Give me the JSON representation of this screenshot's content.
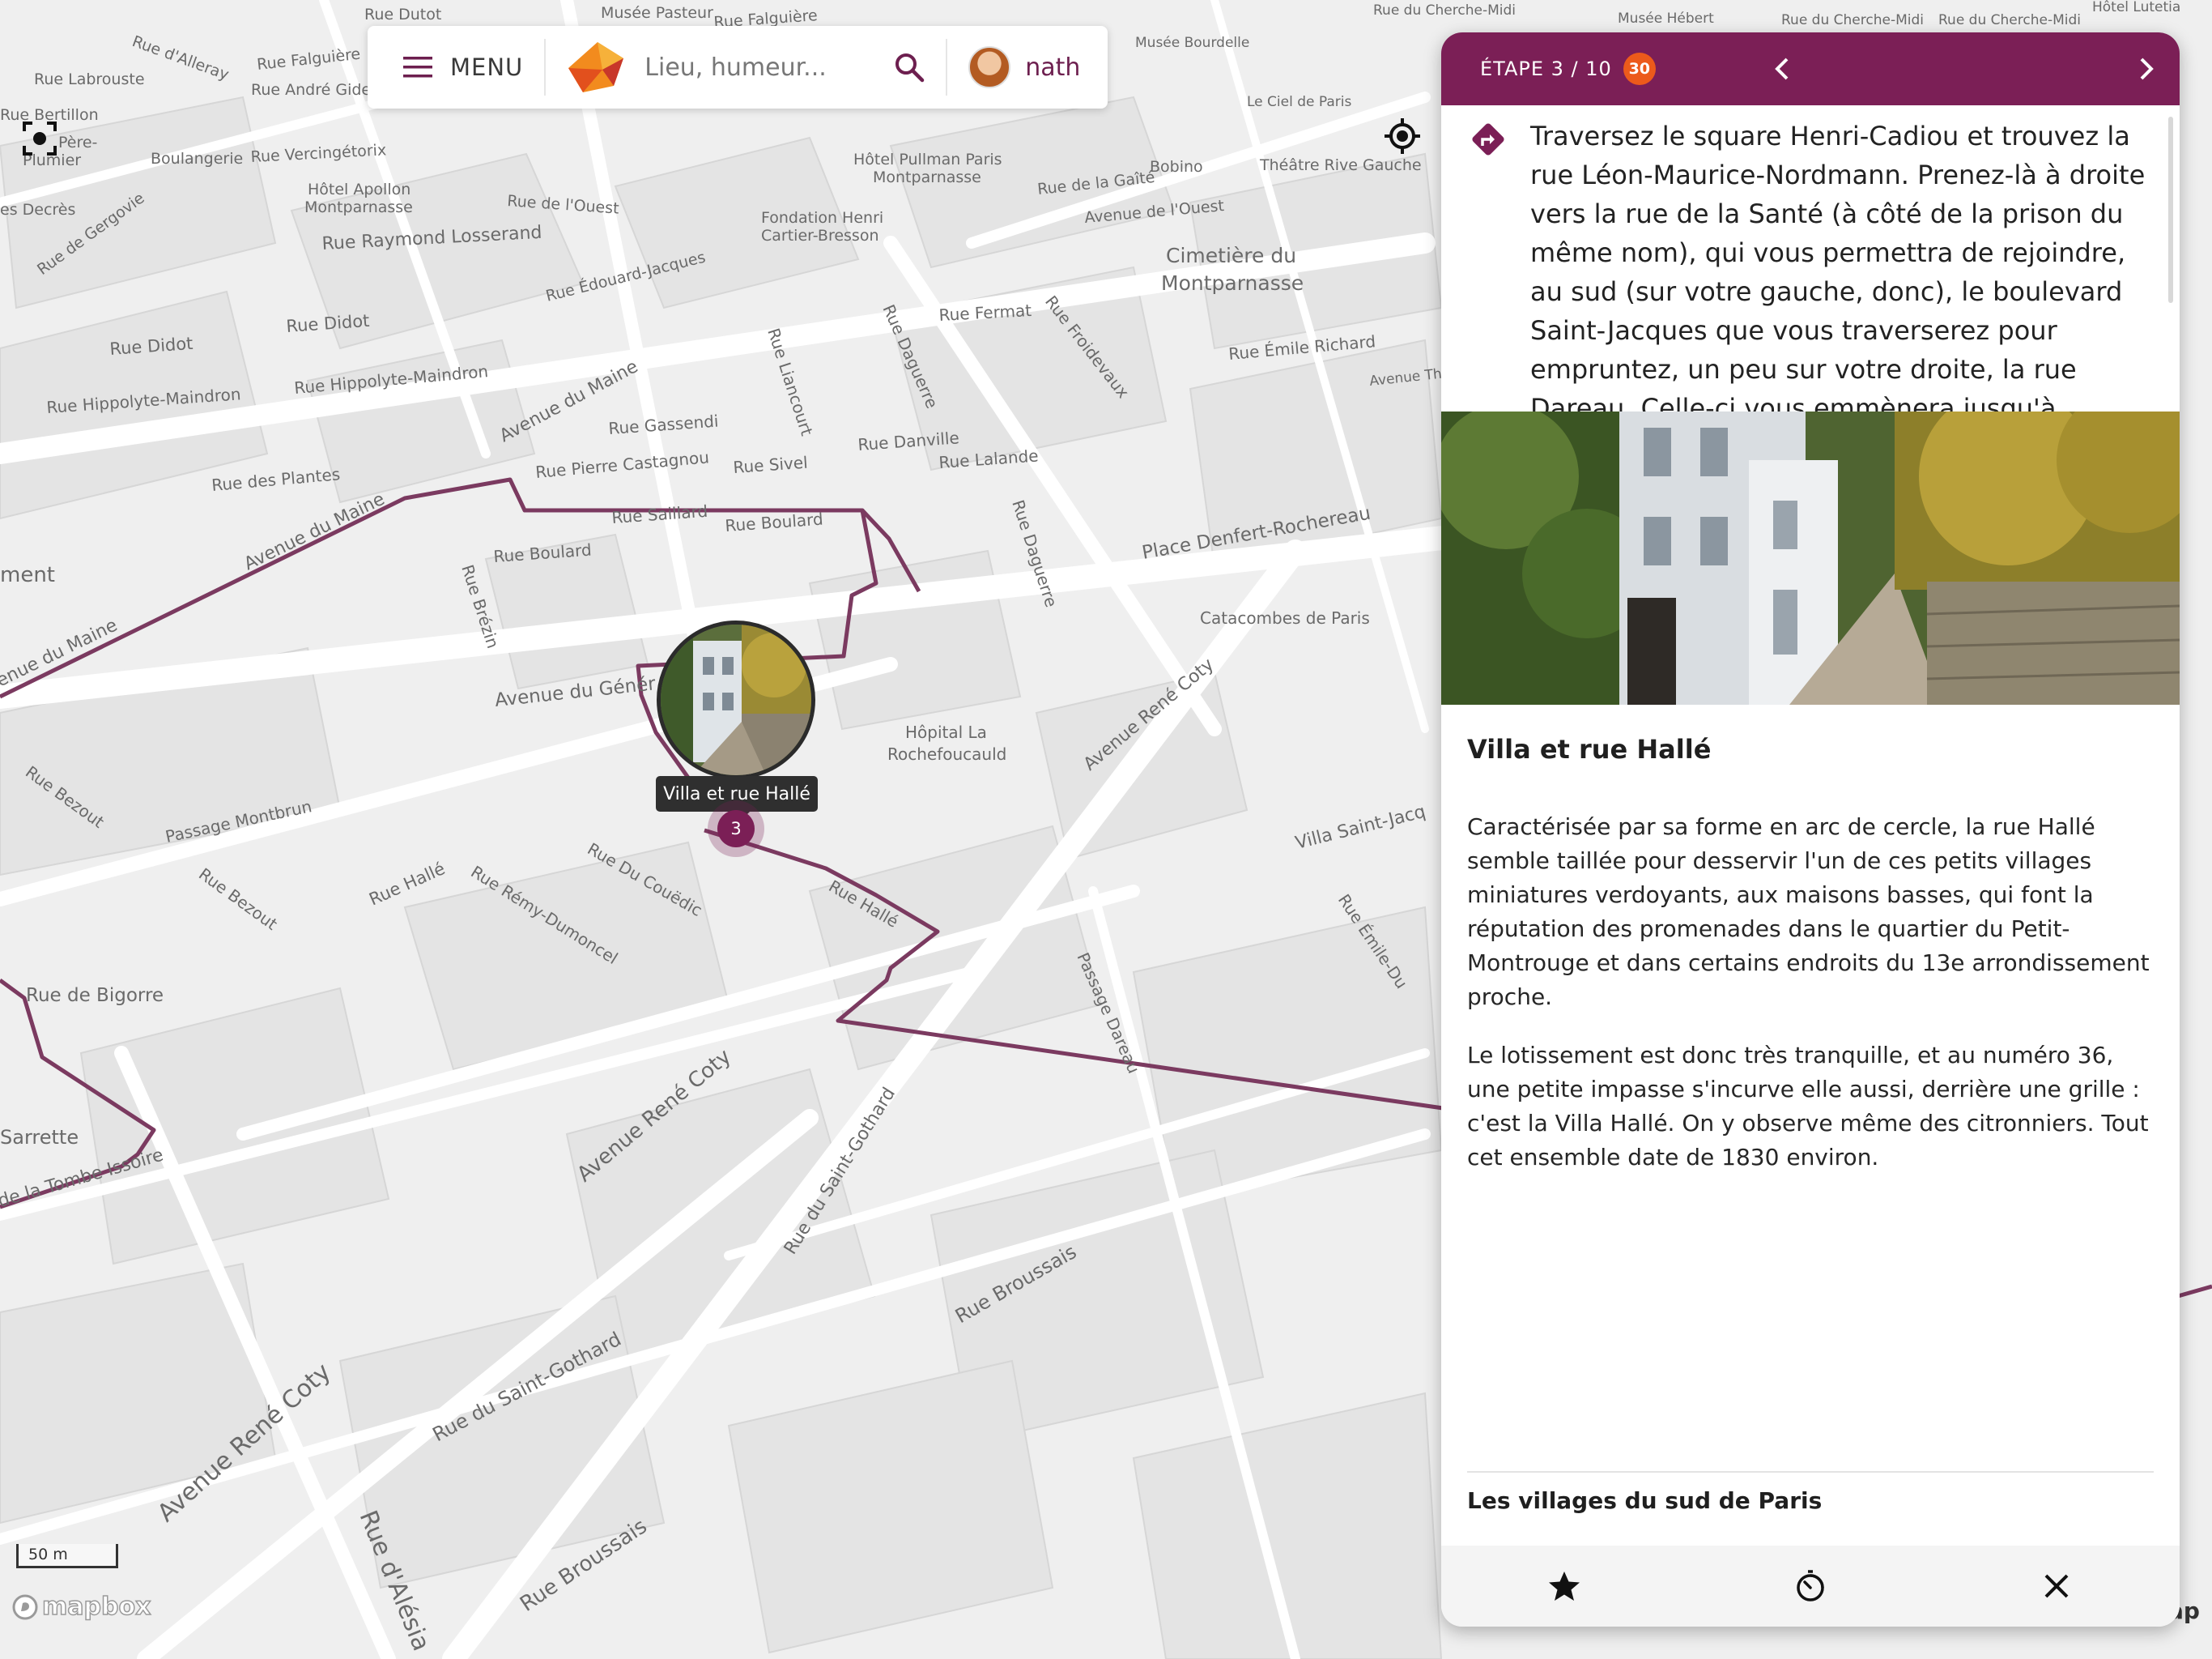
{
  "topbar": {
    "menu_label": "MENU",
    "search_placeholder": "Lieu, humeur...",
    "user_name": "nath"
  },
  "map": {
    "streets": [
      "Rue Dutot",
      "Musée Pasteur",
      "Rue Falguière",
      "Rue d'Alleray",
      "Rue Falguière",
      "Rue Labrouste",
      "Rue André Gide",
      "Rue Bertillon",
      "Père-Plumier",
      "Boulangerie",
      "Rue Vercingétorix",
      "Hôtel Apollon Montparnasse",
      "Hôtel Pullman Paris Montparnasse",
      "Rue de l'Ouest",
      "Fondation Henri Cartier-Bresson",
      "Rue de la Gaîté",
      "Avenue de l'Ouest",
      "Bobino",
      "Théâtre Rive Gauche",
      "Cimetière du Montparnasse",
      "Rue Raymond Losserand",
      "Rue de Gergovie",
      "Rue des Decrès",
      "Rue Édouard-Jacques",
      "Rue Didot",
      "Rue Didot",
      "Rue Hippolyte-Maindron",
      "Rue Hippolyte-Maindron",
      "Avenue du Maine",
      "Rue Gassendi",
      "Rue Pierre Castagnou",
      "Rue Sivel",
      "Rue Liancourt",
      "Rue Daguerre",
      "Rue Fermat",
      "Rue Froidevaux",
      "Rue Émile Richard",
      "Rue Danville",
      "Rue Lalande",
      "Rue des Plantes",
      "Avenue du Maine",
      "Rue Saillard",
      "Rue Boulard",
      "Rue Boulard",
      "Rue Daguerre",
      "Place Denfert-Rochereau",
      "Catacombes de Paris",
      "Rue Brézin",
      "Avenue du Maine",
      "Avenue du Général",
      "Hôpital La Rochefoucauld",
      "Avenue René Coty",
      "Rue Bezout",
      "Passage Montbrun",
      "Rue Bezout",
      "Rue Hallé",
      "Rue Rémy-Dumoncel",
      "Rue Du Couëdic",
      "Rue Hallé",
      "Villa Saint-Jacques",
      "Rue Émile-Dubois",
      "Rue de Bigorre",
      "Passage Dareau",
      "Avenue René Coty",
      "Rue du Saint-Gothard",
      "Sarrette",
      "de la Tombe Issoire",
      "Rue Broussais",
      "Rue du Saint-Gothard",
      "Avenue René Coty",
      "Rue d'Alésia",
      "Rue Broussais",
      "Musée Hébert",
      "Rue du Cherche-Midi",
      "Rue du Cherche-Midi",
      "Rue du Cherche-Midi",
      "Musée Bourdelle",
      "Hôtel Lutetia",
      "Le Ciel de Paris",
      "ment",
      "enue du Maine"
    ]
  },
  "marker": {
    "tooltip": "Villa et rue Hallé",
    "number": "3"
  },
  "scale_label": "50 m",
  "attribution": {
    "mapbox": "mapbox",
    "partial": "ap"
  },
  "panel": {
    "step_label": "ÉTAPE 3 / 10",
    "step_badge": "30",
    "directions": "Traversez le square Henri-Cadiou et trouvez la rue Léon-Maurice-Nordmann. Prenez-là à droite vers la rue de la Santé (à côté de la prison du même nom), qui vous permettra de rejoindre, au sud (sur votre gauche, donc), le boulevard Saint-Jacques que vous traverserez pour empruntez, un peu sur votre droite, la rue Dareau. Celle-ci vous emmènera jusqu'à",
    "poi_title": "Villa et rue Hallé",
    "paragraphs": [
      "Caractérisée par sa forme en arc de cercle, la rue Hallé semble taillée pour desservir l'un de ces petits villages miniatures verdoyants, aux maisons basses, qui font la réputation des promenades dans le quartier du Petit-Montrouge et dans certains endroits du 13e arrondissement proche.",
      "Le lotissement est donc très tranquille, et au numéro 36, une petite impasse s'incurve elle aussi, derrière une grille : c'est la Villa Hallé. On y observe même des citronniers. Tout cet ensemble date de 1830 environ."
    ],
    "series_title": "Les villages du sud de Paris",
    "footer_icons": [
      "star-icon",
      "timer-icon",
      "close-icon"
    ]
  },
  "colors": {
    "brand": "#7b1f56",
    "badge": "#ec5a1b",
    "route": "#7b3a60",
    "map_bg": "#efefef"
  }
}
